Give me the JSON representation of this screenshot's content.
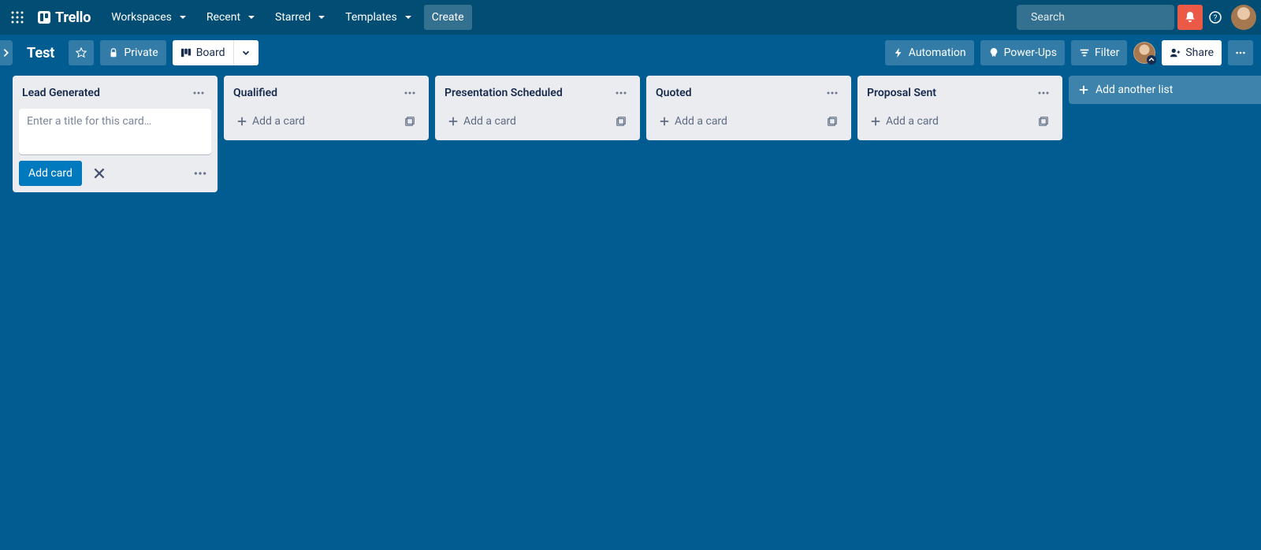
{
  "header": {
    "brand": "Trello",
    "nav": {
      "workspaces": "Workspaces",
      "recent": "Recent",
      "starred": "Starred",
      "templates": "Templates"
    },
    "create": "Create",
    "search_placeholder": "Search"
  },
  "boardBar": {
    "title": "Test",
    "visibility": "Private",
    "viewLabel": "Board",
    "automation": "Automation",
    "powerups": "Power-Ups",
    "filter": "Filter",
    "share": "Share"
  },
  "lists": [
    {
      "title": "Lead Generated",
      "composing": true
    },
    {
      "title": "Qualified",
      "composing": false
    },
    {
      "title": "Presentation Scheduled",
      "composing": false
    },
    {
      "title": "Quoted",
      "composing": false
    },
    {
      "title": "Proposal Sent",
      "composing": false
    }
  ],
  "compose": {
    "placeholder": "Enter a title for this card…",
    "addCard": "Add card"
  },
  "strings": {
    "addACard": "Add a card",
    "addAnotherList": "Add another list"
  }
}
